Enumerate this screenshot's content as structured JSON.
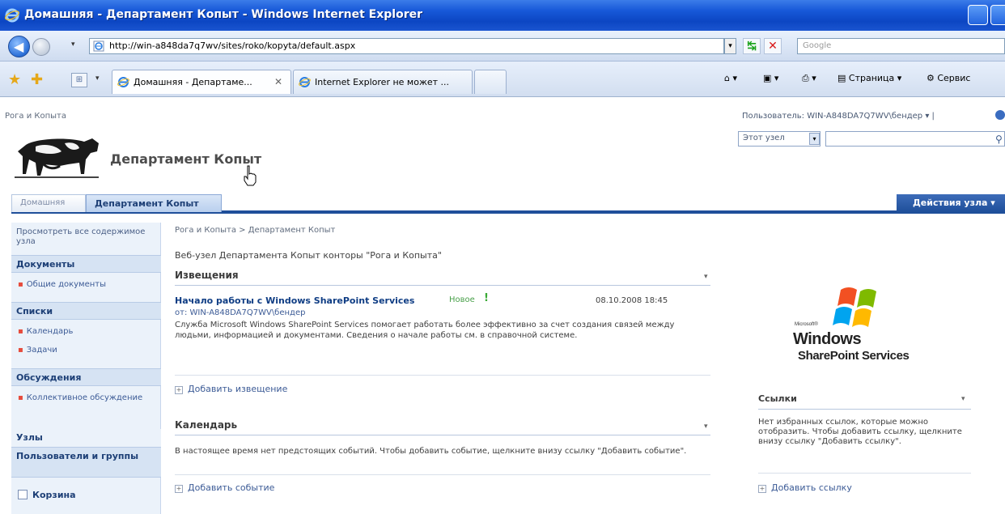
{
  "browser": {
    "window_title": "Домашняя - Департамент Копыт - Windows Internet Explorer",
    "address": "http://win-a848da7q7wv/sites/roko/kopyta/default.aspx",
    "search_placeholder": "Google",
    "tabs": [
      {
        "label": "Домашняя - Департаме...",
        "active": true
      },
      {
        "label": "Internet Explorer не может ...",
        "active": false
      }
    ],
    "commands": {
      "page": "Страница",
      "tools": "Сервис"
    },
    "nav_dropdown": "▾"
  },
  "site": {
    "top_breadcrumb": "Рога и Копыта",
    "user_menu": "Пользователь: WIN-A848DA7Q7WV\\бендер ▾ |",
    "title": "Департамент Копыт",
    "search_scope": "Этот узел",
    "top_nav": {
      "home": "Домашняя",
      "active": "Департамент Копыт",
      "site_actions": "Действия узла ▾"
    }
  },
  "quick_launch": {
    "view_all": "Просмотреть все содержимое узла",
    "documents_header": "Документы",
    "documents_items": [
      "Общие документы"
    ],
    "lists_header": "Списки",
    "lists_items": [
      "Календарь",
      "Задачи"
    ],
    "discussions_header": "Обсуждения",
    "discussions_items": [
      "Коллективное обсуждение"
    ],
    "sites_header": "Узлы",
    "people_header": "Пользователи и группы",
    "recycle_bin": "Корзина"
  },
  "main": {
    "breadcrumb": "Рога и Копыта > Департамент Копыт",
    "description": "Веб-узел Департамента Копыт конторы \"Рога и Копыта\"",
    "announcements": {
      "title": "Извещения",
      "menu": "▾",
      "item_title": "Начало работы с Windows SharePoint Services",
      "item_new": "Новое",
      "item_date": "08.10.2008 18:45",
      "item_from": "от: WIN-A848DA7Q7WV\\бендер",
      "item_body": "Служба Microsoft Windows SharePoint Services помогает работать более эффективно за счет создания связей между людьми, информацией и документами. Сведения о начале работы см. в справочной системе.",
      "add_link": "Добавить извещение"
    },
    "calendar": {
      "title": "Календарь",
      "menu": "▾",
      "body": "В настоящее время нет предстоящих событий. Чтобы добавить событие, щелкните внизу ссылку \"Добавить событие\".",
      "add_link": "Добавить событие"
    }
  },
  "right": {
    "logo_ms": "Microsoft®",
    "logo_line1": "Windows",
    "logo_line2": "SharePoint Services",
    "links": {
      "title": "Ссылки",
      "menu": "▾",
      "body": "Нет избранных ссылок, которые можно отобразить. Чтобы добавить ссылку, щелкните внизу ссылку \"Добавить ссылку\".",
      "add_link": "Добавить ссылку"
    }
  }
}
